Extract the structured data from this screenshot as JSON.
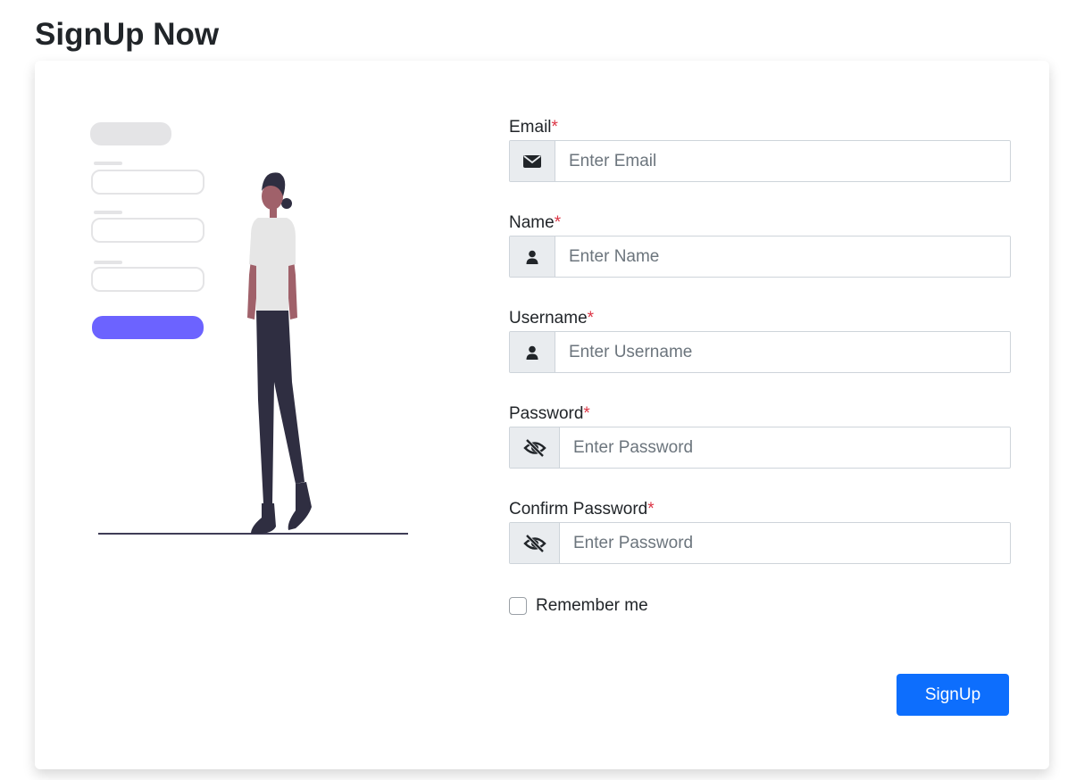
{
  "page": {
    "title": "SignUp Now"
  },
  "form": {
    "fields": [
      {
        "label": "Email",
        "required_mark": "*",
        "placeholder": "Enter Email",
        "value": "",
        "icon": "envelope-icon"
      },
      {
        "label": "Name",
        "required_mark": "*",
        "placeholder": "Enter Name",
        "value": "",
        "icon": "user-icon"
      },
      {
        "label": "Username",
        "required_mark": "*",
        "placeholder": "Enter Username",
        "value": "",
        "icon": "user-icon"
      },
      {
        "label": "Password",
        "required_mark": "*",
        "placeholder": "Enter Password",
        "value": "",
        "icon": "eye-slash-icon"
      },
      {
        "label": "Confirm Password",
        "required_mark": "*",
        "placeholder": "Enter Password",
        "value": "",
        "icon": "eye-slash-icon"
      }
    ],
    "remember": {
      "label": "Remember me",
      "checked": false
    },
    "submit_label": "SignUp"
  },
  "colors": {
    "primary": "#0d6efd",
    "required": "#dc3545",
    "illustration_accent": "#6c63ff"
  }
}
